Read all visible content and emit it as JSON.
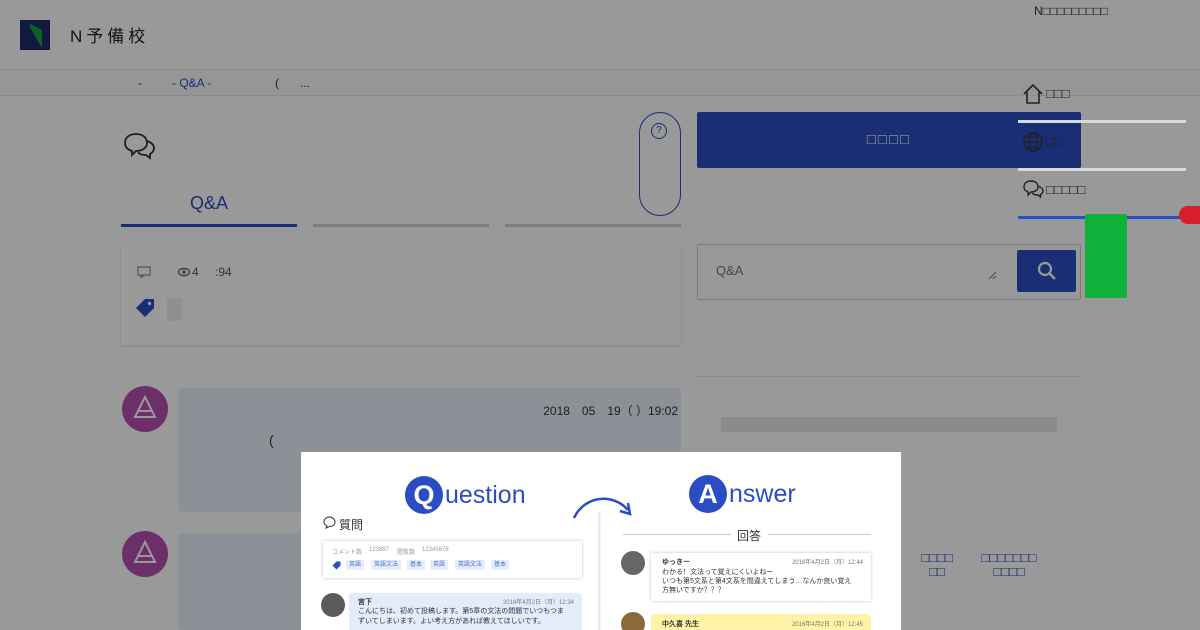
{
  "header": {
    "brand": "N予備校",
    "school_name": "N□□□□□□□□□"
  },
  "breadcrumb": {
    "items": [
      "-",
      "- Q&A -",
      "(",
      "..."
    ]
  },
  "tabs": [
    "Q&A",
    "",
    ""
  ],
  "help_label": "?",
  "question_card": {
    "views": "4",
    "count": ":94"
  },
  "posts": [
    {
      "date": "2018　05　19（ ）19:02",
      "text": "("
    },
    {
      "date": "",
      "text": ""
    }
  ],
  "ask_button": "□□□□",
  "search": {
    "placeholder": "Q&A"
  },
  "side_links": [
    "□□□□\n□□",
    "□□□□□□□\n□□□□"
  ],
  "floating_nav": [
    {
      "icon": "home-icon",
      "label": "□□□"
    },
    {
      "icon": "globe-icon",
      "label": "□□"
    },
    {
      "icon": "chat-bubbles-icon",
      "label": "□□□□□"
    }
  ],
  "modal": {
    "question_word": "uestion",
    "question_letter": "Q",
    "answer_word": "nswer",
    "answer_letter": "A",
    "question_heading": "質問",
    "answer_heading": "回答",
    "stats": {
      "comments": "コメント数",
      "likes": "123887",
      "views_label": "閲覧数",
      "views": "12345678"
    },
    "chips": [
      "英語",
      "英語文法",
      "基本",
      "英語",
      "英語文法",
      "基本"
    ],
    "question_post": {
      "name": "宮下",
      "date": "2016年4月2日（月）12:34",
      "lines": [
        "こんにちは、初めて投稿します。第5章の文法の問題でいつもつま",
        "ずいてしまいます。よい考え方があれば教えてほしいです。"
      ]
    },
    "answer_posts": [
      {
        "name": "ゆっきー",
        "date": "2016年4月2日（月）12:44",
        "lines": [
          "わかる！文法って覚えにくいよねー",
          "いつも第5文系と第4文系を間違えてしまう…なんか良い覚え",
          "方無いですか？？？"
        ]
      },
      {
        "name": "中久喜 先生",
        "date": "2016年4月2日（月）12:45",
        "lines": []
      }
    ]
  },
  "colors": {
    "accent": "#2a4dc4",
    "avatar": "#b64fb0",
    "bubble": "#e9f1fc",
    "green": "#11b03a",
    "red": "#d91d2f",
    "teacher_bubble": "#fff3a8"
  }
}
